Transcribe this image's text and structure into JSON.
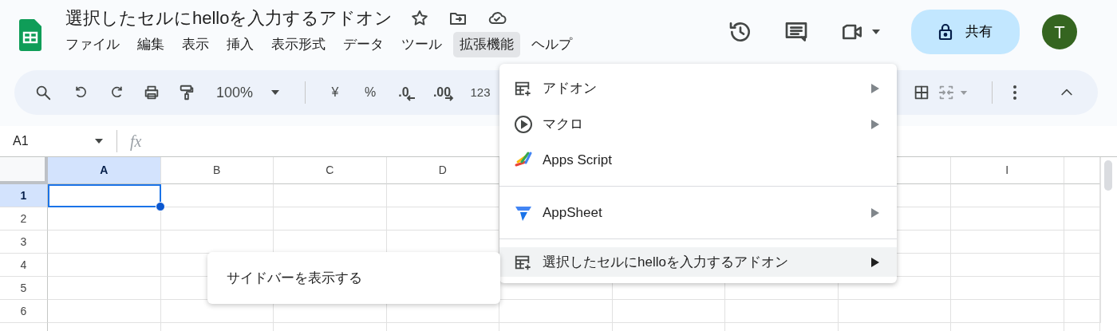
{
  "document": {
    "title": "選択したセルにhelloを入力するアドオン"
  },
  "menubar": [
    {
      "label": "ファイル",
      "selected": false
    },
    {
      "label": "編集",
      "selected": false
    },
    {
      "label": "表示",
      "selected": false
    },
    {
      "label": "挿入",
      "selected": false
    },
    {
      "label": "表示形式",
      "selected": false
    },
    {
      "label": "データ",
      "selected": false
    },
    {
      "label": "ツール",
      "selected": false
    },
    {
      "label": "拡張機能",
      "selected": true
    },
    {
      "label": "ヘルプ",
      "selected": false
    }
  ],
  "share_button": {
    "label": "共有"
  },
  "avatar": {
    "initial": "T"
  },
  "toolbar": {
    "zoom": "100%",
    "currency": "¥",
    "percent": "%",
    "decimal_decrease": ".0",
    "decimal_increase": ".00",
    "number_format": "123"
  },
  "formula_bar": {
    "name_box": "A1",
    "fx_label": "fx"
  },
  "grid": {
    "columns_left": [
      {
        "label": "A",
        "selected": true
      },
      {
        "label": "B",
        "selected": false
      },
      {
        "label": "C",
        "selected": false
      },
      {
        "label": "D",
        "selected": false
      }
    ],
    "columns_right": [
      {
        "label": "I",
        "selected": false
      }
    ],
    "rows": [
      {
        "label": "1",
        "selected": true
      },
      {
        "label": "2",
        "selected": false
      },
      {
        "label": "3",
        "selected": false
      },
      {
        "label": "4",
        "selected": false
      },
      {
        "label": "5",
        "selected": false
      },
      {
        "label": "6",
        "selected": false
      }
    ]
  },
  "extensions_menu": {
    "groups": [
      [
        {
          "kind": "addon",
          "label": "アドオン",
          "has_submenu": true,
          "selected": false
        },
        {
          "kind": "macro",
          "label": "マクロ",
          "has_submenu": true,
          "selected": false
        },
        {
          "kind": "script",
          "label": "Apps Script",
          "has_submenu": false,
          "selected": false
        }
      ],
      [
        {
          "kind": "appsheet",
          "label": "AppSheet",
          "has_submenu": true,
          "selected": false
        }
      ],
      [
        {
          "kind": "addon",
          "label": "選択したセルにhelloを入力するアドオン",
          "has_submenu": true,
          "selected": true
        }
      ]
    ]
  },
  "submenu": {
    "items": [
      {
        "label": "サイドバーを表示する"
      }
    ]
  }
}
